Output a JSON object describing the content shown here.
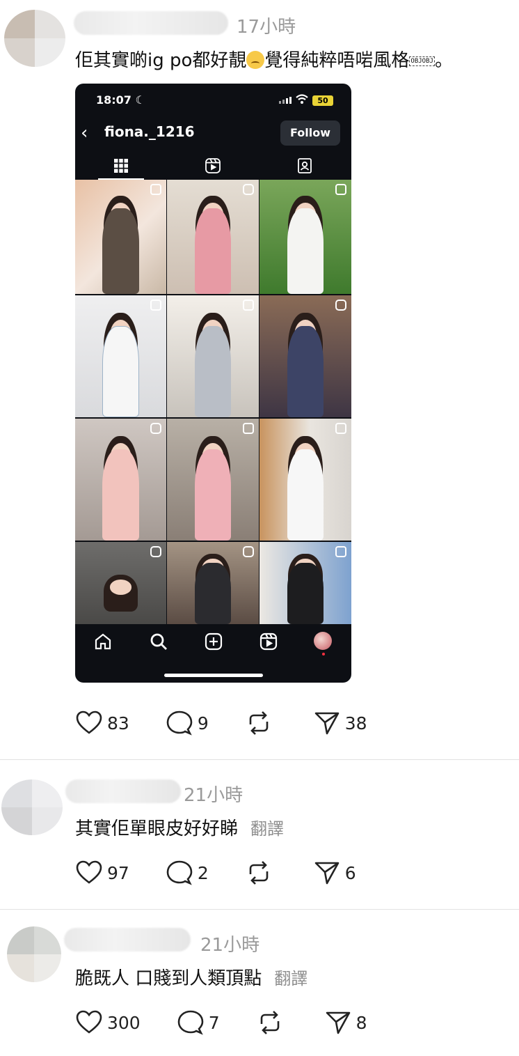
{
  "colors": {
    "background": "#ffffff",
    "meta_text": "#9a9a9a",
    "divider": "#e2e2e2",
    "phone_bg": "#0d0f14"
  },
  "posts": [
    {
      "time": "17小時",
      "text_before_emoji": "佢其實啲ig po都好靚",
      "emoji": "downcast-sweat-face",
      "text_after_emoji": "覺得純粹唔啱風格",
      "obj_marker": "OBJOBJ",
      "text_end": "。",
      "likes": "83",
      "replies": "9",
      "reposts": "",
      "shares": "38"
    },
    {
      "time": "21小時",
      "text": "其實佢單眼皮好好睇",
      "translate": "翻譯",
      "likes": "97",
      "replies": "2",
      "reposts": "",
      "shares": "6"
    },
    {
      "time": "21小時",
      "text": "脆既人 口賤到人類頂點",
      "translate": "翻譯",
      "likes": "300",
      "replies": "7",
      "reposts": "",
      "shares": "8"
    }
  ],
  "embedded_screenshot": {
    "status_time": "18:07",
    "battery": "50",
    "username": "fiona._1216",
    "follow_label": "Follow",
    "tabs": [
      "grid-icon",
      "reels-icon",
      "tagged-icon"
    ],
    "nav": [
      "home-icon",
      "search-icon",
      "create-icon",
      "reels-icon",
      "profile-avatar"
    ]
  }
}
